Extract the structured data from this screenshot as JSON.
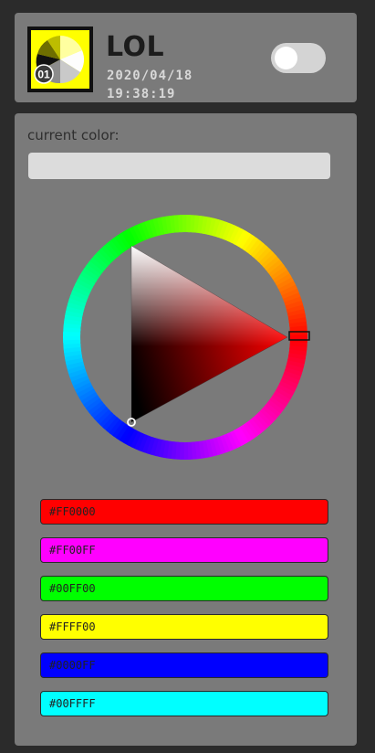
{
  "header": {
    "title": "LOL",
    "date": "2020/04/18",
    "time": "19:38:19",
    "badge": "01",
    "toggle_on": false
  },
  "main": {
    "current_color_label": "current color:",
    "current_color_value": "",
    "swatches": [
      {
        "label": "#FF0000",
        "color": "#FF0000"
      },
      {
        "label": "#FF00FF",
        "color": "#FF00FF"
      },
      {
        "label": "#00FF00",
        "color": "#00FF00"
      },
      {
        "label": "#FFFF00",
        "color": "#FFFF00"
      },
      {
        "label": "#0000FF",
        "color": "#0000FF"
      },
      {
        "label": "#00FFFF",
        "color": "#00FFFF"
      }
    ]
  }
}
